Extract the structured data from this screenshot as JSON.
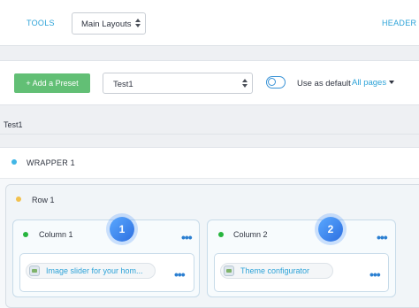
{
  "toolbar": {
    "tools_label": "TOOLS",
    "layout_select_value": "Main Layouts",
    "header_label": "HEADER"
  },
  "preset_bar": {
    "add_preset_label": "+ Add a Preset",
    "preset_select_value": "Test1",
    "use_default_label": "Use as default",
    "all_pages_label": "All pages"
  },
  "layout_name": "Test1",
  "wrapper": {
    "label": "WRAPPER 1",
    "dot_color": "#40b6e6"
  },
  "row": {
    "label": "Row 1",
    "dot_color": "#f2c14e"
  },
  "columns": [
    {
      "label": "Column 1",
      "badge": "1",
      "more": "•••",
      "module": {
        "label": "Image slider for your hom...",
        "icon": "image-module-icon",
        "more": "•••"
      }
    },
    {
      "label": "Column 2",
      "badge": "2",
      "more": "•••",
      "module": {
        "label": "Theme configurator",
        "icon": "theme-module-icon",
        "more": "•••"
      }
    }
  ],
  "colors": {
    "accent": "#2ea3d8",
    "add_button": "#62bf75",
    "column_dot": "#27b53e",
    "badge": "#3b82f6"
  }
}
